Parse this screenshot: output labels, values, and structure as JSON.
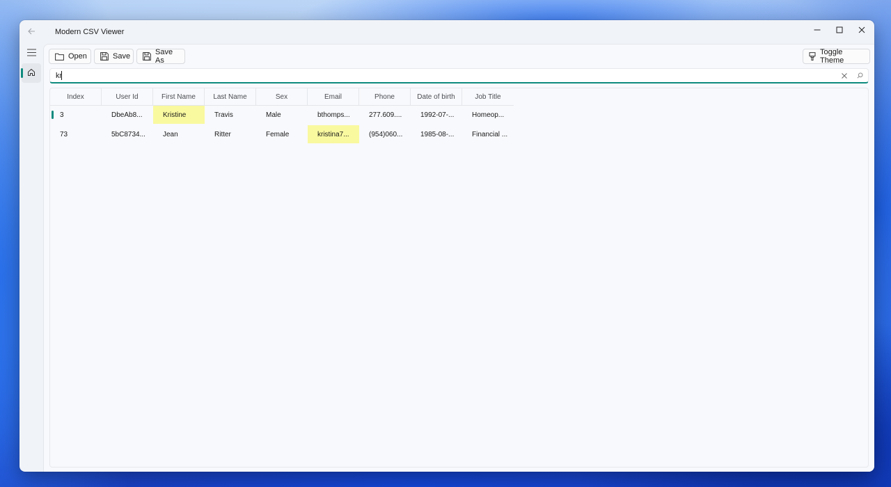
{
  "window": {
    "title": "Modern CSV Viewer"
  },
  "toolbar": {
    "open_label": "Open",
    "save_label": "Save",
    "save_as_label": "Save As",
    "toggle_theme_label": "Toggle Theme"
  },
  "search": {
    "value": "kr"
  },
  "grid": {
    "columns": [
      "Index",
      "User Id",
      "First Name",
      "Last Name",
      "Sex",
      "Email",
      "Phone",
      "Date of birth",
      "Job Title"
    ],
    "rows": [
      [
        "3",
        "DbeAb8...",
        "Kristine",
        "Travis",
        "Male",
        "bthomps...",
        "277.609....",
        "1992-07-...",
        "Homeop..."
      ],
      [
        "73",
        "5bC8734...",
        "Jean",
        "Ritter",
        "Female",
        "kristina7...",
        "(954)060...",
        "1985-08-...",
        "Financial ..."
      ]
    ]
  },
  "colors": {
    "accent": "#0e8a7e",
    "highlight": "#f9f9a0"
  },
  "icons": [
    "back-arrow-icon",
    "minimize-icon",
    "maximize-icon",
    "close-icon",
    "hamburger-icon",
    "home-icon",
    "folder-icon",
    "save-icon",
    "save-as-icon",
    "paintbrush-icon",
    "clear-icon",
    "search-icon"
  ]
}
